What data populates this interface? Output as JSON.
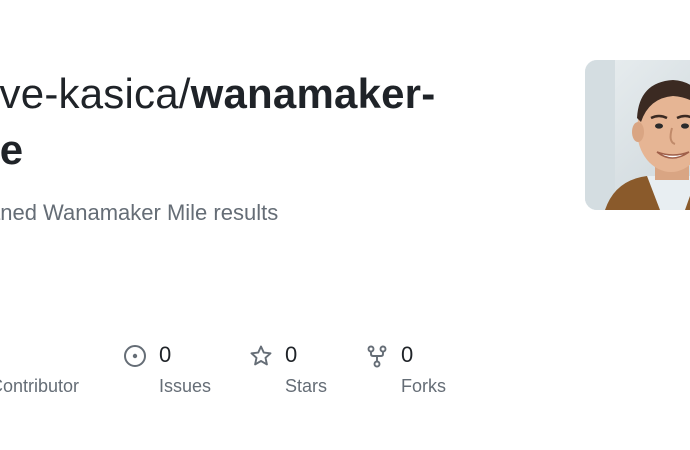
{
  "repo": {
    "owner": "eve-kasica/",
    "name_line1": "wanamaker-",
    "name_line2": "ile",
    "description": "aned Wanamaker Mile results"
  },
  "avatar": {
    "icon": "user-avatar-photo"
  },
  "stats": {
    "contributors": {
      "label": "Contributor"
    },
    "issues": {
      "count": "0",
      "label": "Issues",
      "icon": "issue-opened-icon"
    },
    "stars": {
      "count": "0",
      "label": "Stars",
      "icon": "star-icon"
    },
    "forks": {
      "count": "0",
      "label": "Forks",
      "icon": "repo-forked-icon"
    }
  },
  "colors": {
    "text_primary": "#1f2328",
    "text_muted": "#656d76"
  }
}
